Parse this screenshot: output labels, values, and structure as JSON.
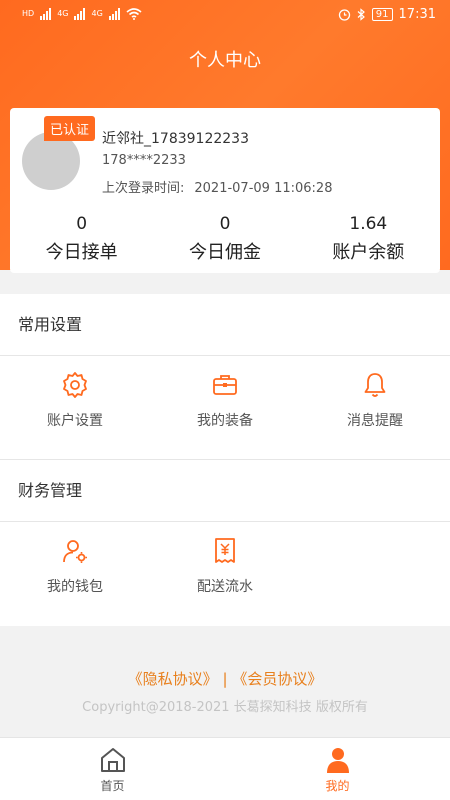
{
  "statusbar": {
    "net1": "HD",
    "net2": "4G",
    "net3": "4G",
    "battery": "91",
    "time": "17:31"
  },
  "header": {
    "title": "个人中心"
  },
  "profile": {
    "badge": "已认证",
    "username": "近邻社_17839122233",
    "phone": "178****2233",
    "last_login_label": "上次登录时间:",
    "last_login_time": "2021-07-09 11:06:28"
  },
  "stats": [
    {
      "value": "0",
      "label": "今日接单"
    },
    {
      "value": "0",
      "label": "今日佣金"
    },
    {
      "value": "1.64",
      "label": "账户余额"
    }
  ],
  "common_settings": {
    "title": "常用设置",
    "items": [
      {
        "label": "账户设置",
        "icon": "gear-icon"
      },
      {
        "label": "我的装备",
        "icon": "briefcase-icon"
      },
      {
        "label": "消息提醒",
        "icon": "bell-icon"
      }
    ]
  },
  "finance": {
    "title": "财务管理",
    "items": [
      {
        "label": "我的钱包",
        "icon": "user-gear-icon"
      },
      {
        "label": "配送流水",
        "icon": "receipt-icon"
      }
    ]
  },
  "footer": {
    "privacy": "《隐私协议》",
    "separator": "|",
    "member": "《会员协议》",
    "copyright": "Copyright@2018-2021 长葛探知科技 版权所有"
  },
  "tabbar": {
    "items": [
      {
        "label": "首页",
        "icon": "home-icon",
        "active": false
      },
      {
        "label": "我的",
        "icon": "person-icon",
        "active": true
      }
    ]
  },
  "colors": {
    "accent": "#ff6a1f",
    "link": "#e8801e",
    "tab_inactive": "#555555"
  }
}
